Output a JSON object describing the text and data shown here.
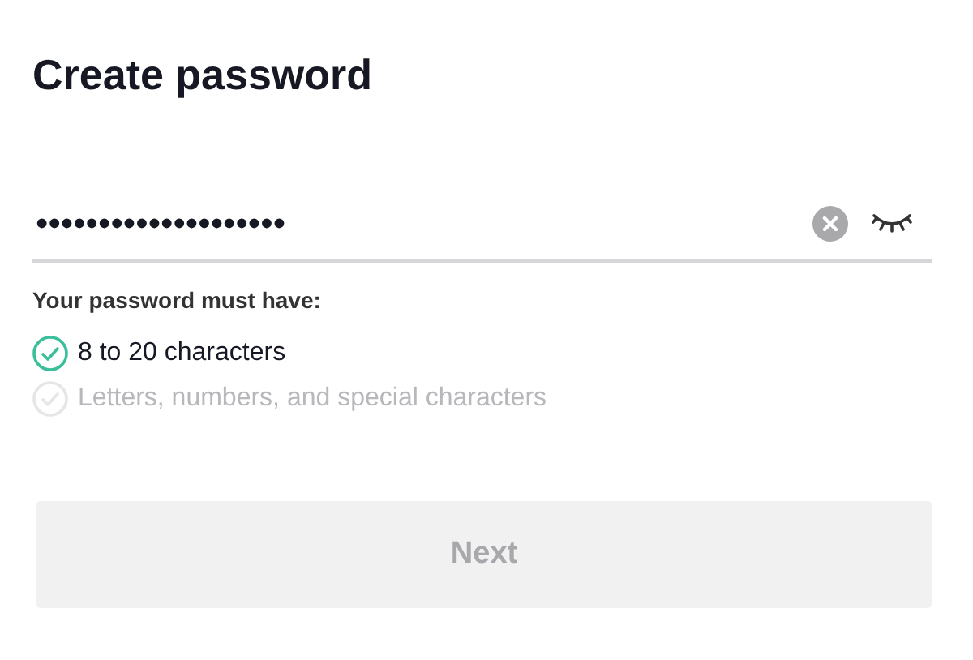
{
  "title": "Create password",
  "password_field": {
    "value": "••••••••••••••••••••"
  },
  "hint": "Your password must have:",
  "requirements": [
    {
      "label": "8 to 20 characters",
      "met": true
    },
    {
      "label": "Letters, numbers, and special characters",
      "met": false
    }
  ],
  "next_button": {
    "label": "Next",
    "disabled": true
  }
}
